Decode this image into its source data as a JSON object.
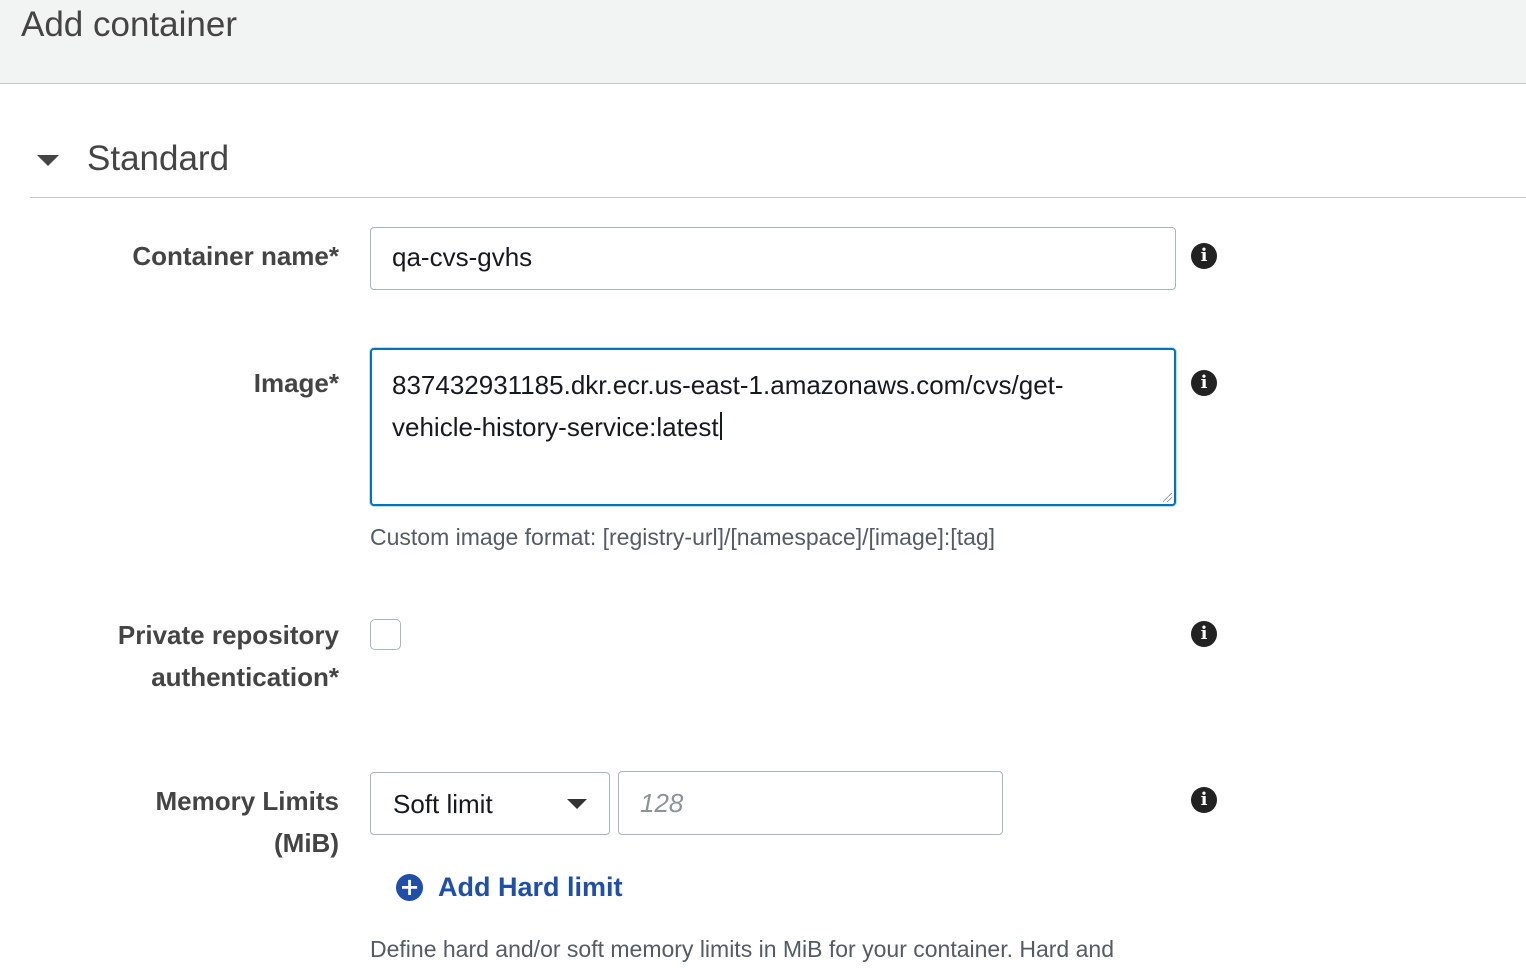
{
  "header": {
    "title": "Add container"
  },
  "section": {
    "title": "Standard"
  },
  "container_name": {
    "label": "Container name*",
    "value": "qa-cvs-gvhs"
  },
  "image": {
    "label": "Image*",
    "value_line1": "837432931185.dkr.ecr.us-east-1.amazonaws.com/cvs/get-",
    "value_line2": "vehicle-history-service:latest",
    "hint": "Custom image format: [registry-url]/[namespace]/[image]:[tag]"
  },
  "private_repo": {
    "label_line1": "Private repository",
    "label_line2": "authentication*",
    "checked": false
  },
  "memory": {
    "label_line1": "Memory Limits",
    "label_line2": "(MiB)",
    "limit_type": "Soft limit",
    "placeholder": "128",
    "add_link": "Add Hard limit",
    "hint": "Define hard and/or soft memory limits in MiB for your container. Hard and"
  },
  "icons": {
    "info": "info-icon",
    "toggle": "caret-down-icon",
    "add": "plus-circle-icon"
  },
  "colors": {
    "link": "#1f4fa8",
    "focus_border": "#0073bb"
  }
}
